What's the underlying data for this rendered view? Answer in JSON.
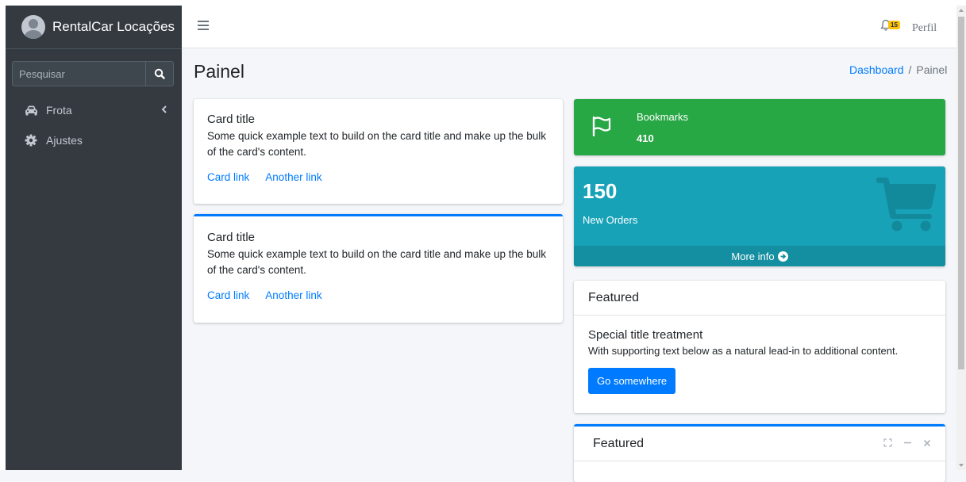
{
  "brand": {
    "name": "RentalCar Locações"
  },
  "search": {
    "placeholder": "Pesquisar"
  },
  "sidebar": {
    "items": [
      {
        "label": "Frota",
        "icon": "car-icon",
        "has_chevron": true
      },
      {
        "label": "Ajustes",
        "icon": "gear-icon",
        "has_chevron": false
      }
    ]
  },
  "header": {
    "notifications_count": "15",
    "profile_label": "Perfil"
  },
  "page": {
    "title": "Painel",
    "breadcrumb": [
      "Dashboard",
      "Painel"
    ]
  },
  "cards": [
    {
      "title": "Card title",
      "text": "Some quick example text to build on the card title and make up the bulk of the card's content.",
      "link1": "Card link",
      "link2": "Another link"
    },
    {
      "title": "Card title",
      "text": "Some quick example text to build on the card title and make up the bulk of the card's content.",
      "link1": "Card link",
      "link2": "Another link"
    }
  ],
  "info_box": {
    "label": "Bookmarks",
    "value": "410",
    "icon": "flag-icon"
  },
  "small_box": {
    "value": "150",
    "label": "New Orders",
    "footer": "More info",
    "icon": "shopping-cart-icon"
  },
  "featured": {
    "header": "Featured",
    "title": "Special title treatment",
    "text": "With supporting text below as a natural lead-in to additional content.",
    "button": "Go somewhere"
  },
  "featured2": {
    "header": "Featured"
  },
  "colors": {
    "sidebar_bg": "#343a40",
    "primary": "#007bff",
    "success": "#28a745",
    "info": "#17a2b8",
    "warning": "#ffc107"
  }
}
